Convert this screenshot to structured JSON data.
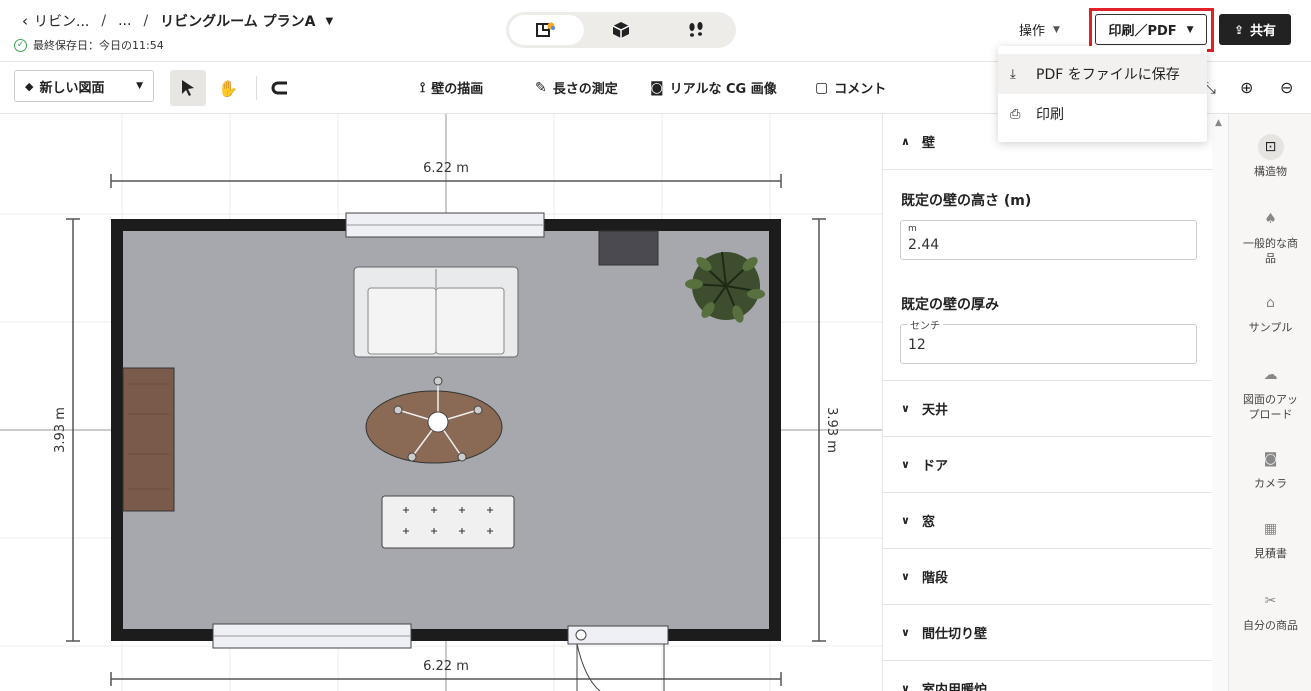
{
  "header": {
    "back_label": "リビン...",
    "ellipsis": "...",
    "title": "リビングルーム プランA",
    "saved_label": "最終保存日：今日の11:54",
    "ops_label": "操作",
    "print_label": "印刷／PDF",
    "share_label": "共有"
  },
  "dropdown": {
    "items": [
      {
        "label": "PDF をファイルに保存"
      },
      {
        "label": "印刷"
      }
    ]
  },
  "toolbar": {
    "floor_select": "新しい図面",
    "draw_wall": "壁の描画",
    "measure": "長さの測定",
    "cg_image": "リアルな CG 画像",
    "comment": "コメント"
  },
  "canvas": {
    "dim_top": "6.22 m",
    "dim_bottom": "6.22 m",
    "dim_left": "3.93 m",
    "dim_right": "3.93 m"
  },
  "panel": {
    "wall_section": "壁",
    "height_label": "既定の壁の高さ (m)",
    "height_unit": "m",
    "height_value": "2.44",
    "thickness_label": "既定の壁の厚み",
    "thickness_unit": "センチ",
    "thickness_value": "12",
    "sections": [
      "天井",
      "ドア",
      "窓",
      "階段",
      "間仕切り壁",
      "室内用暖炉"
    ]
  },
  "rail": {
    "items": [
      {
        "label": "構造物"
      },
      {
        "label": "一般的な商品"
      },
      {
        "label": "サンプル"
      },
      {
        "label": "図面のアップロード"
      },
      {
        "label": "カメラ"
      },
      {
        "label": "見積書"
      },
      {
        "label": "自分の商品"
      }
    ]
  },
  "colors": {
    "highlight": "#e0202a",
    "floor": "#a6a8ad",
    "wall": "#1c1c1c",
    "cabinet": "#7a5a4a"
  }
}
